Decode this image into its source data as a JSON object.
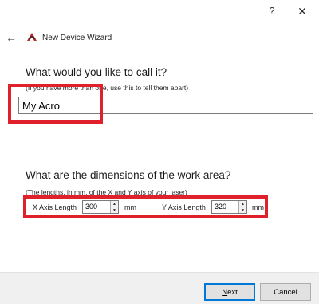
{
  "titlebar": {
    "help_glyph": "?",
    "close_glyph": "✕"
  },
  "header": {
    "back_glyph": "←",
    "title": "New Device Wizard"
  },
  "name_section": {
    "question": "What would you like to call it?",
    "hint": "(If you have more than one, use this to tell them apart)",
    "value": "My Acro"
  },
  "dimensions_section": {
    "question": "What are the dimensions of the work area?",
    "hint": "(The lengths, in mm, of the X and Y axis of your laser)",
    "x_label": "X Axis Length",
    "x_value": "300",
    "x_unit": "mm",
    "y_label": "Y Axis Length",
    "y_value": "320",
    "y_unit": "mm"
  },
  "footer": {
    "next_mnemonic": "N",
    "next_rest": "ext",
    "cancel_label": "Cancel"
  },
  "colors": {
    "annotation_red": "#e0202a",
    "focus_blue": "#0078d7"
  }
}
